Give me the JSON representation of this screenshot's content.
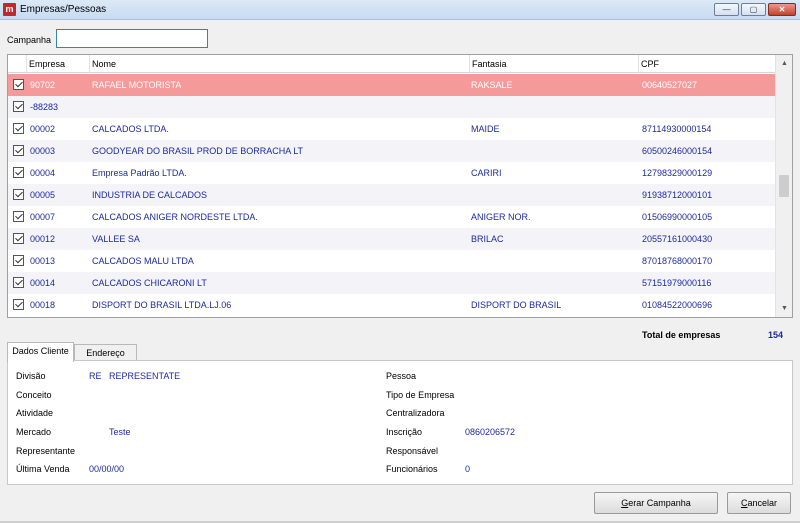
{
  "window": {
    "title": "Empresas/Pessoas",
    "controls": {
      "minimize": "—",
      "maximize": "▢",
      "close": "✕"
    }
  },
  "campanha": {
    "label": "Campanha",
    "value": ""
  },
  "grid": {
    "columns": [
      "Empresa",
      "Nome",
      "Fantasia",
      "CPF"
    ],
    "rows": [
      {
        "checked": true,
        "empresa": "90702",
        "nome": "RAFAEL MOTORISTA",
        "fantasia": "RAKSALE",
        "cpf": "00640527027",
        "selected": true
      },
      {
        "checked": true,
        "empresa": "-88283",
        "nome": "",
        "fantasia": "",
        "cpf": ""
      },
      {
        "checked": true,
        "empresa": "00002",
        "nome": "CALCADOS  LTDA.",
        "fantasia": "MAIDE",
        "cpf": "87114930000154"
      },
      {
        "checked": true,
        "empresa": "00003",
        "nome": "GOODYEAR DO BRASIL PROD DE BORRACHA LT",
        "fantasia": "",
        "cpf": "60500246000154"
      },
      {
        "checked": true,
        "empresa": "00004",
        "nome": "Empresa Padrão LTDA.",
        "fantasia": "CARIRI",
        "cpf": "12798329000129"
      },
      {
        "checked": true,
        "empresa": "00005",
        "nome": "INDUSTRIA DE CALCADOS",
        "fantasia": "",
        "cpf": "91938712000101"
      },
      {
        "checked": true,
        "empresa": "00007",
        "nome": "CALCADOS ANIGER NORDESTE LTDA.",
        "fantasia": "ANIGER NOR.",
        "cpf": "01506990000105"
      },
      {
        "checked": true,
        "empresa": "00012",
        "nome": "VALLEE SA",
        "fantasia": "BRILAC",
        "cpf": "20557161000430"
      },
      {
        "checked": true,
        "empresa": "00013",
        "nome": "CALCADOS MALU LTDA",
        "fantasia": "",
        "cpf": "87018768000170"
      },
      {
        "checked": true,
        "empresa": "00014",
        "nome": "CALCADOS CHICARONI LT",
        "fantasia": "",
        "cpf": "57151979000116"
      },
      {
        "checked": true,
        "empresa": "00018",
        "nome": "DISPORT DO BRASIL LTDA.LJ.06",
        "fantasia": "DISPORT DO BRASIL",
        "cpf": "01084522000696"
      }
    ]
  },
  "total": {
    "label": "Total de empresas",
    "value": "154"
  },
  "tabs": [
    {
      "label": "Dados Cliente",
      "active": true
    },
    {
      "label": "Endereço",
      "active": false
    }
  ],
  "details": {
    "divisao": {
      "label": "Divisão",
      "code": "RE",
      "value": "REPRESENTATE"
    },
    "conceito": {
      "label": "Conceito",
      "value": ""
    },
    "atividade": {
      "label": "Atividade",
      "value": ""
    },
    "mercado": {
      "label": "Mercado",
      "value": "Teste"
    },
    "representante": {
      "label": "Representante",
      "value": ""
    },
    "ultima_venda": {
      "label": "Última Venda",
      "value": "00/00/00"
    },
    "pessoa": {
      "label": "Pessoa",
      "value": ""
    },
    "tipo_empresa": {
      "label": "Tipo de Empresa",
      "value": ""
    },
    "centralizadora": {
      "label": "Centralizadora",
      "value": ""
    },
    "inscricao": {
      "label": "Inscrição",
      "value": "0860206572"
    },
    "responsavel": {
      "label": "Responsável",
      "value": ""
    },
    "funcionarios": {
      "label": "Funcionários",
      "value": "0"
    }
  },
  "buttons": {
    "gerar": {
      "label": "Gerar Campanha",
      "underline": "G",
      "rest": "erar Campanha"
    },
    "cancelar": {
      "label": "Cancelar",
      "underline": "C",
      "rest": "ancelar"
    }
  }
}
